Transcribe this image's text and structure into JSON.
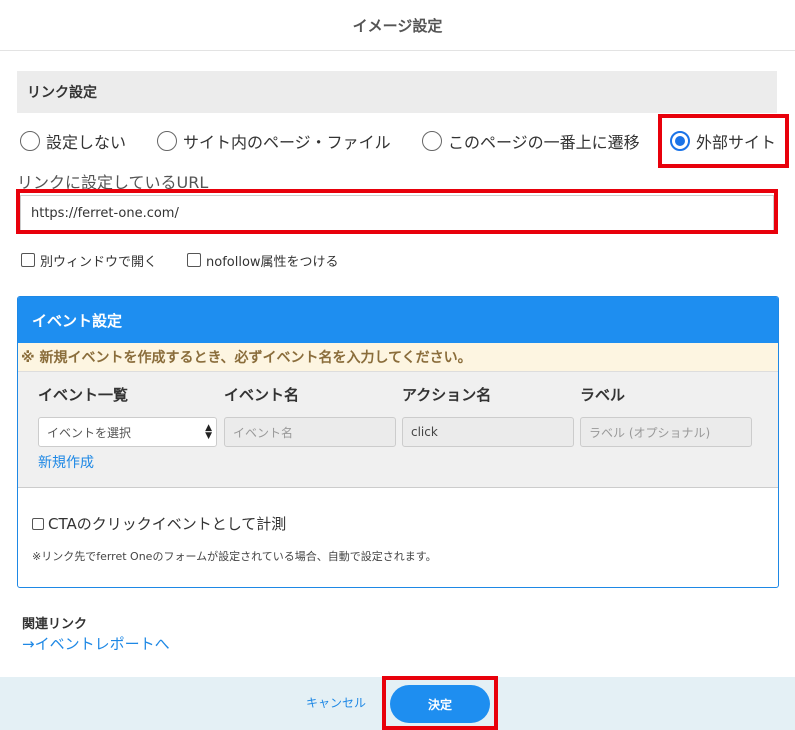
{
  "dialog": {
    "title": "イメージ設定"
  },
  "link_settings": {
    "section_title": "リンク設定",
    "radio_options": [
      {
        "label": "設定しない",
        "checked": false
      },
      {
        "label": "サイト内のページ・ファイル",
        "checked": false
      },
      {
        "label": "このページの一番上に遷移",
        "checked": false
      },
      {
        "label": "外部サイト",
        "checked": true
      }
    ],
    "url_label": "リンクに設定しているURL",
    "url_value": "https://ferret-one.com/",
    "checkboxes": [
      {
        "label": "別ウィンドウで開く",
        "checked": false
      },
      {
        "label": "nofollow属性をつける",
        "checked": false
      }
    ]
  },
  "event_settings": {
    "title": "イベント設定",
    "warning": "※ 新規イベントを作成するとき、必ずイベント名を入力してください。",
    "columns": [
      "イベント一覧",
      "イベント名",
      "アクション名",
      "ラベル"
    ],
    "event_select": "イベントを選択",
    "event_name_placeholder": "イベント名",
    "action_name_value": "click",
    "label_placeholder": "ラベル (オプショナル)",
    "new_link": "新規作成",
    "cta_checkbox": {
      "label": "CTAのクリックイベントとして計測",
      "checked": false
    },
    "note": "※リンク先でferret Oneのフォームが設定されている場合、自動で設定されます。"
  },
  "related": {
    "title": "関連リンク",
    "link": "→イベントレポートへ"
  },
  "footer": {
    "cancel_label": "キャンセル",
    "ok_label": "決定"
  },
  "colors": {
    "accent": "#1e8ef0",
    "highlight": "#e8000b",
    "warning_bg": "#fdf5e1",
    "footer_bg": "#e4f0f5"
  }
}
